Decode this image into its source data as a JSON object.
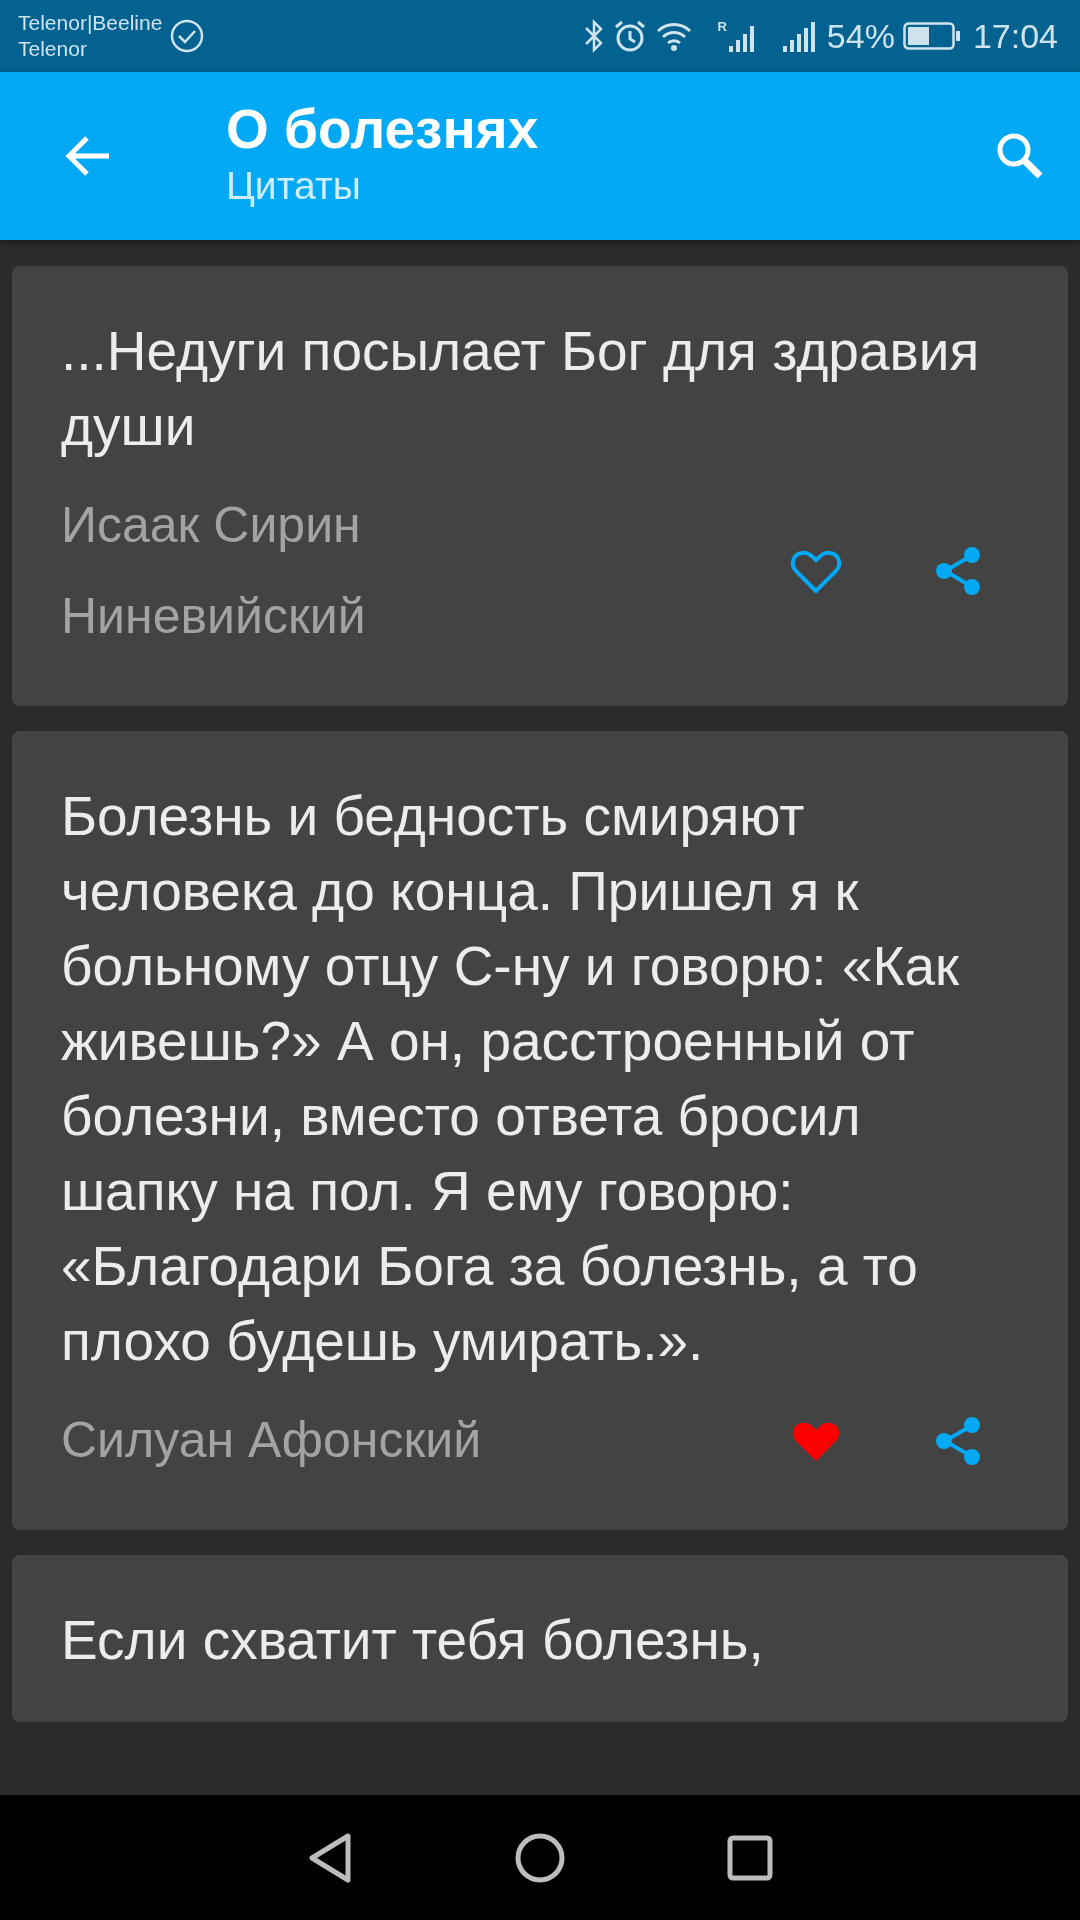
{
  "status_bar": {
    "carrier_1": "Telenor|Beeline",
    "carrier_2": "Telenor",
    "roaming_mark": "R",
    "battery_percent": "54%",
    "level": 0.5,
    "time": "17:04"
  },
  "app_bar": {
    "title": "О болезнях",
    "subtitle": "Цитаты"
  },
  "quotes": [
    {
      "text": "...Недуги посылает Бог для здравия души",
      "author": "Исаак Сирин Ниневийский",
      "favorite": false
    },
    {
      "text": "Болезнь и бедность смиряют человека до конца. Пришел я к больному отцу С-ну и говорю: «Как живешь?» А он, расстроенный от болезни, вместо ответа бросил шапку на пол. Я ему говорю: «Благодари Бога за болезнь, а то плохо будешь умирать.».",
      "author": "Силуан Афонский",
      "favorite": true
    },
    {
      "text": "Если схватит тебя болезнь,"
    }
  ]
}
